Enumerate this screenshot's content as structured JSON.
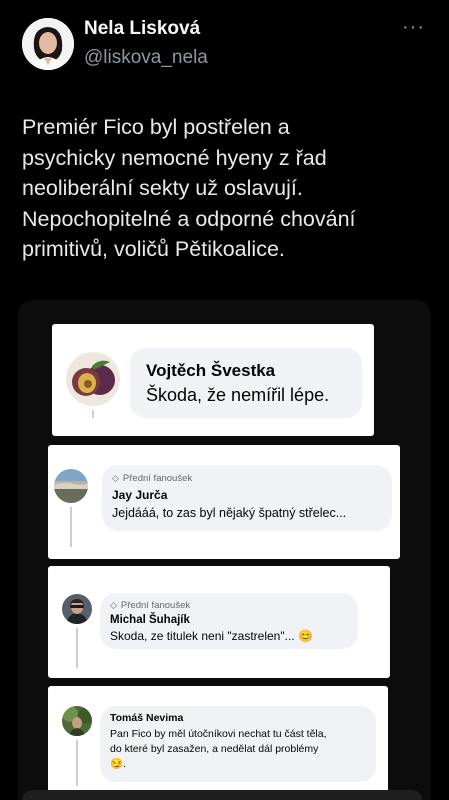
{
  "author": {
    "name": "Nela Lisková",
    "handle": "@liskova_nela"
  },
  "more_menu_icon": "ellipsis-icon",
  "tweet": {
    "text": "Premiér Fico byl postřelen a\npsychicky nemocné hyeny z řad\nneoliberální sekty už oslavují.\nNepochopitelné a odporné chování\nprimitivů, voličů Pětikoalice."
  },
  "comments": [
    {
      "name": "Vojtěch Švestka",
      "text": "Škoda, že nemířil lépe.",
      "avatar": "plum-avatar"
    },
    {
      "badge": "Přední fanoušek",
      "name": "Jay Jurča",
      "text": "Jejdááá, to zas byl nějaký špatný střelec...",
      "avatar": "landscape-avatar"
    },
    {
      "badge": "Přední fanoušek",
      "name": "Michal Šuhajík",
      "text": "Skoda, ze titulek neni \"zastrelen\"... 😊",
      "avatar": "man-avatar"
    },
    {
      "name": "Tomáš Nevima",
      "text": "Pan Fico by měl útočníkovi nechat tu část těla,\ndo které byl zasažen, a nedělat dál problémy\n😏.",
      "avatar": "outdoor-avatar"
    }
  ],
  "colors": {
    "background": "#000000",
    "text": "#e7e9ea",
    "secondary": "#8b98a5",
    "card": "#ffffff",
    "bubble": "#f0f2f5"
  }
}
